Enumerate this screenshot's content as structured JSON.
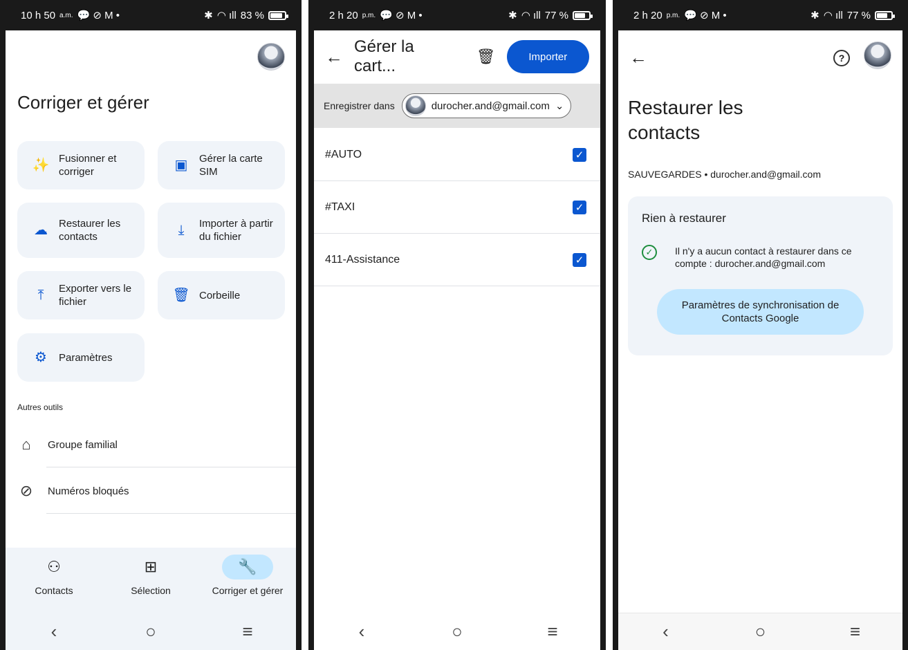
{
  "phone1": {
    "status": {
      "time": "10 h 50",
      "ampm": "a.m.",
      "notif_icons": "💬 ⊘ M •",
      "battery": "83 %",
      "battery_level": 0.83
    },
    "title": "Corriger et gérer",
    "tiles": [
      {
        "label": "Fusionner et corriger",
        "icon": "magic-wand-icon"
      },
      {
        "label": "Gérer la carte SIM",
        "icon": "sim-card-icon"
      },
      {
        "label": "Restaurer les contacts",
        "icon": "cloud-restore-icon"
      },
      {
        "label": "Importer à partir du fichier",
        "icon": "download-icon"
      },
      {
        "label": "Exporter vers le fichier",
        "icon": "upload-icon"
      },
      {
        "label": "Corbeille",
        "icon": "trash-icon"
      },
      {
        "label": "Paramètres",
        "icon": "gear-icon"
      }
    ],
    "autres_outils": "Autres outils",
    "tools": [
      {
        "label": "Groupe familial",
        "icon": "family-home-icon"
      },
      {
        "label": "Numéros bloqués",
        "icon": "block-icon"
      }
    ],
    "bottom_nav": [
      {
        "label": "Contacts",
        "icon": "person-icon"
      },
      {
        "label": "Sélection",
        "icon": "highlight-icon"
      },
      {
        "label": "Corriger et gérer",
        "icon": "wrench-icon",
        "active": true
      }
    ]
  },
  "phone2": {
    "status": {
      "time": "2 h 20",
      "ampm": "p.m.",
      "notif_icons": "💬 ⊘ M •",
      "battery": "77 %",
      "battery_level": 0.77
    },
    "title": "Gérer la cart...",
    "import_label": "Importer",
    "save_in_label": "Enregistrer dans",
    "account": "durocher.and@gmail.com",
    "sim_contacts": [
      {
        "name": "#AUTO",
        "checked": true
      },
      {
        "name": "#TAXI",
        "checked": true
      },
      {
        "name": "411-Assistance",
        "checked": true
      }
    ]
  },
  "phone3": {
    "status": {
      "time": "2 h 20",
      "ampm": "p.m.",
      "notif_icons": "💬 ⊘ M •",
      "battery": "77 %",
      "battery_level": 0.77
    },
    "title": "Restaurer les contacts",
    "subtitle": "SAUVEGARDES • durocher.and@gmail.com",
    "card_title": "Rien à restaurer",
    "card_message": "Il n'y a aucun contact à restaurer dans ce compte : durocher.and@gmail.com",
    "sync_button": "Paramètres de synchronisation de Contacts Google"
  },
  "colors": {
    "accent": "#0b57d0",
    "tile_bg": "#f0f4f9",
    "active_pill": "#c2e7ff",
    "success": "#1e8e3e"
  }
}
